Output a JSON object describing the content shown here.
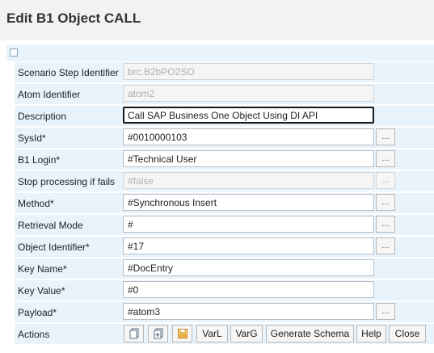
{
  "dialog": {
    "title": "Edit B1 Object CALL"
  },
  "fields": [
    {
      "label": "Scenario Step Identifier",
      "value": "brc.B2bPO2SO",
      "disabled": true,
      "has_button": false
    },
    {
      "label": "Atom Identifier",
      "value": "atom2",
      "disabled": true,
      "has_button": false
    },
    {
      "label": "Description",
      "value": "Call SAP Business One Object Using DI API",
      "focused": true,
      "has_button": false
    },
    {
      "label": "SysId*",
      "value": "#0010000103",
      "has_button": true
    },
    {
      "label": "B1 Login*",
      "value": "#Technical User",
      "has_button": true
    },
    {
      "label": "Stop processing if fails",
      "value": "#false",
      "disabled": true,
      "has_button": true,
      "button_disabled": true
    },
    {
      "label": "Method*",
      "value": "#Synchronous Insert",
      "has_button": true
    },
    {
      "label": "Retrieval Mode",
      "value": "#",
      "has_button": true
    },
    {
      "label": "Object Identifier*",
      "value": "#17",
      "has_button": true
    },
    {
      "label": "Key Name*",
      "value": "#DocEntry",
      "has_button": false
    },
    {
      "label": "Key Value*",
      "value": "#0",
      "has_button": false
    },
    {
      "label": "Payload*",
      "value": "#atom3",
      "has_button": true
    }
  ],
  "browse_button_label": "...",
  "actions": {
    "label": "Actions",
    "icons": [
      "copy-icon",
      "add-page-icon",
      "save-icon"
    ],
    "buttons": {
      "varl": "VarL",
      "varg": "VarG",
      "generate_schema": "Generate Schema",
      "help": "Help",
      "close": "Close"
    }
  }
}
